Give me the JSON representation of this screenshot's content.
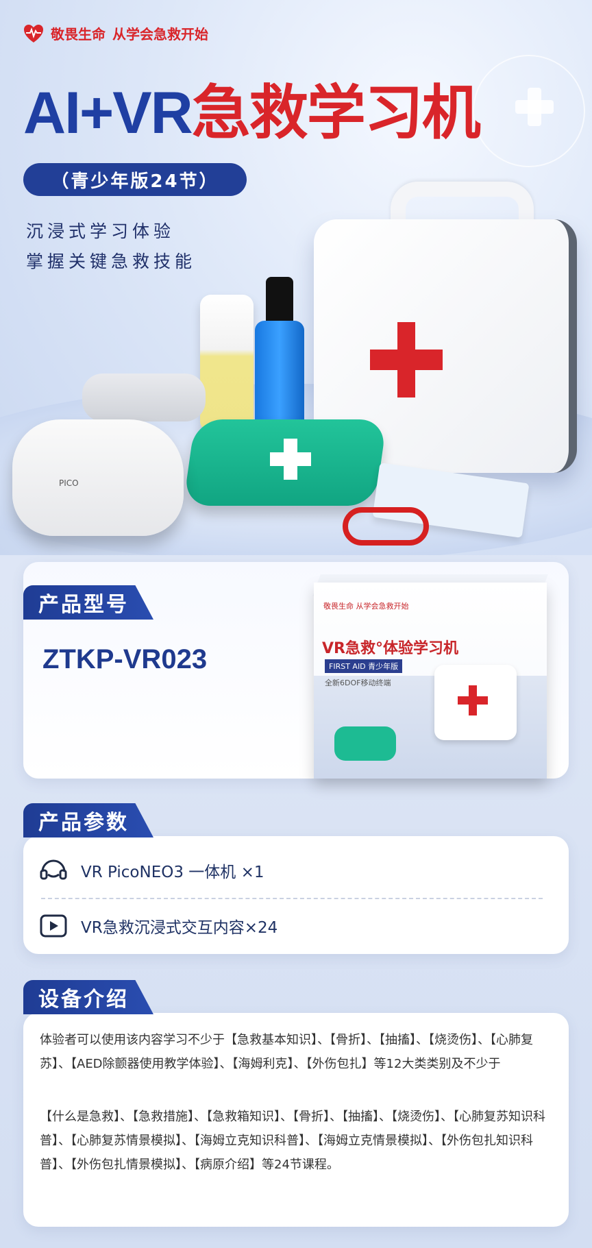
{
  "header": {
    "brand_name": "敬畏生命",
    "brand_slogan": "从学会急救开始",
    "title_blue": "AI+VR",
    "title_red": "急救学习机",
    "edition": "（青少年版24节）",
    "slogan_lines": [
      "沉浸式学习体验",
      "掌握关键急救技能"
    ]
  },
  "hero": {
    "headset_logo": "PICO"
  },
  "model_section": {
    "tag": "产品型号",
    "model": "ZTKP-VR023",
    "box": {
      "brand": "敬畏生命 从学会急救开始",
      "title": "VR急救°体验学习机",
      "tag": "FIRST AID 青少年版",
      "sub": "全新6DOF移动终端"
    }
  },
  "params_section": {
    "tag": "产品参数",
    "items": [
      {
        "icon": "vr-headset-icon",
        "text": "VR PicoNEO3 一体机 ×1"
      },
      {
        "icon": "play-icon",
        "text": "VR急救沉浸式交互内容×24"
      }
    ]
  },
  "intro_section": {
    "tag": "设备介绍",
    "paragraph1": "体验者可以使用该内容学习不少于【急救基本知识】、【骨折】、【抽搐】、【烧烫伤】、【心肺复苏】、【AED除颤器使用教学体验】、【海姆利克】、【外伤包扎】等12大类类别及不少于",
    "paragraph2": "【什么是急救】、【急救措施】、【急救箱知识】、【骨折】、【抽搐】、【烧烫伤】、【心肺复苏知识科普】、【心肺复苏情景模拟】、【海姆立克知识科普】、【海姆立克情景模拟】、【外伤包扎知识科普】、【外伤包扎情景模拟】、【病原介绍】等24节课程。"
  },
  "colors": {
    "brand_blue": "#1f3fa3",
    "brand_red": "#d9252a",
    "tag_blue": "#223f97"
  }
}
